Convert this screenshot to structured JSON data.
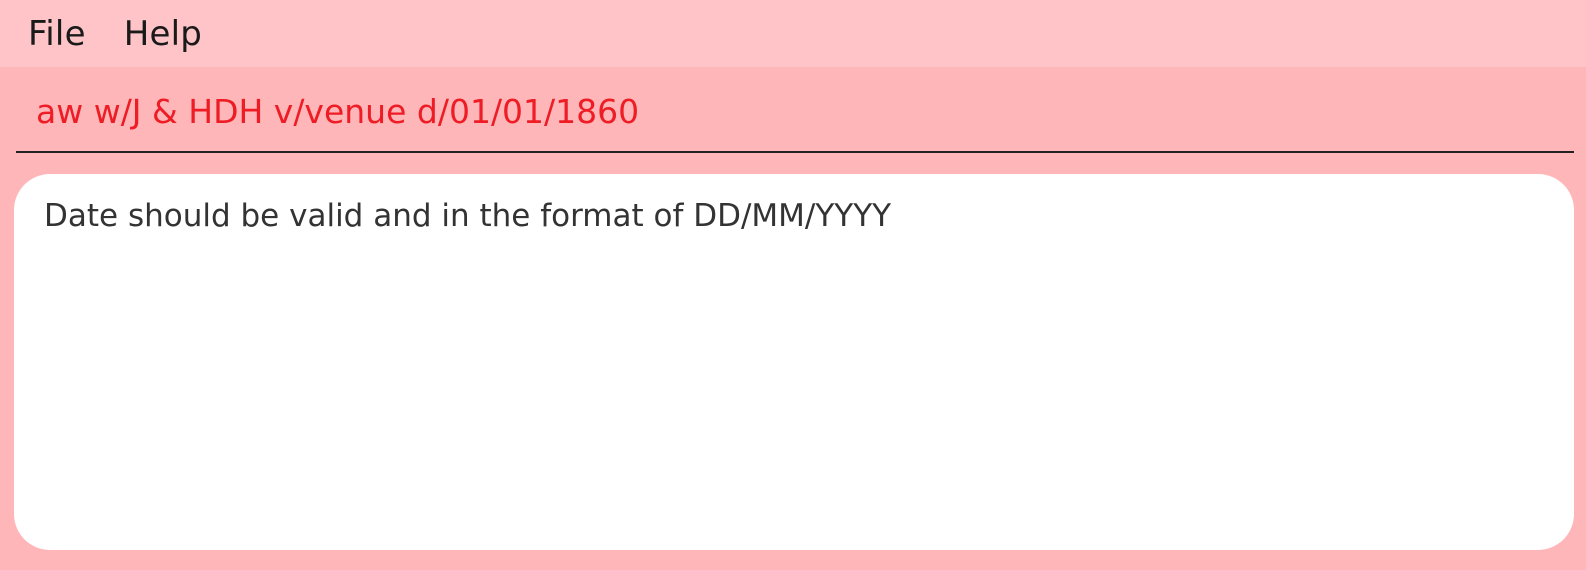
{
  "menubar": {
    "items": [
      {
        "label": "File"
      },
      {
        "label": "Help"
      }
    ]
  },
  "command": {
    "value": "aw w/J & HDH v/venue d/01/01/1860",
    "text_color": "#ee1c25"
  },
  "result": {
    "message": "Date should be valid and in the format of DD/MM/YYYY"
  },
  "colors": {
    "background": "#ffb6b9",
    "menubar": "#ffc4c7",
    "result_background": "#ffffff"
  }
}
